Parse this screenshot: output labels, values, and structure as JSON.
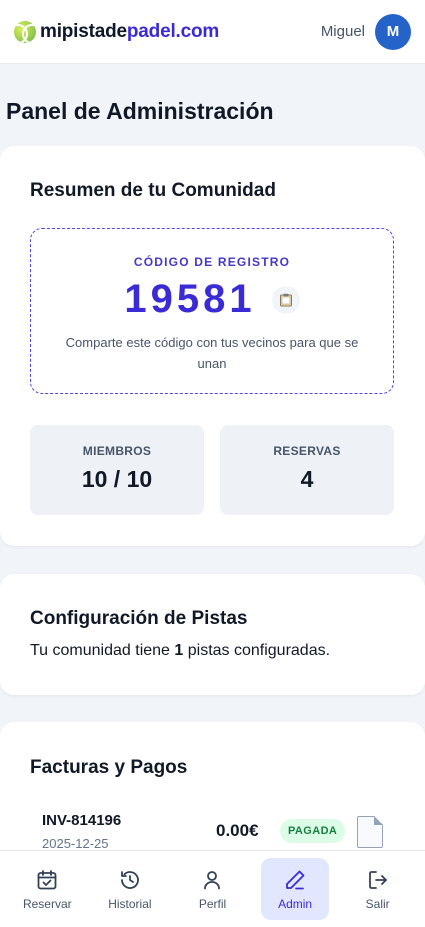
{
  "header": {
    "brand_part1": "mipistade",
    "brand_part2": "padel.com",
    "user_name": "Miguel",
    "avatar_initial": "M"
  },
  "page_title": "Panel de Administración",
  "summary": {
    "title": "Resumen de tu Comunidad",
    "code_label": "CÓDIGO DE REGISTRO",
    "code_value": "19581",
    "code_description": "Comparte este código con tus vecinos para que se unan",
    "members_label": "MIEMBROS",
    "members_value": "10 / 10",
    "bookings_label": "RESERVAS",
    "bookings_value": "4"
  },
  "courts": {
    "title": "Configuración de Pistas",
    "text_before": "Tu comunidad tiene ",
    "count": "1",
    "text_after": " pistas configuradas."
  },
  "invoices": {
    "title": "Facturas y Pagos",
    "items": [
      {
        "id": "INV-814196",
        "date": "2025-12-25",
        "amount": "0.00€",
        "status": "PAGADA"
      }
    ]
  },
  "nav": {
    "items": [
      {
        "label": "Reservar",
        "icon": "calendar-check-icon"
      },
      {
        "label": "Historial",
        "icon": "history-icon"
      },
      {
        "label": "Perfil",
        "icon": "user-icon"
      },
      {
        "label": "Admin",
        "icon": "pencil-icon"
      },
      {
        "label": "Salir",
        "icon": "logout-icon"
      }
    ],
    "active": "Admin"
  },
  "colors": {
    "brand_accent": "#3b2bd6",
    "avatar_bg": "#2563c9",
    "status_paid_bg": "#dcfce7",
    "status_paid_text": "#15803d"
  }
}
